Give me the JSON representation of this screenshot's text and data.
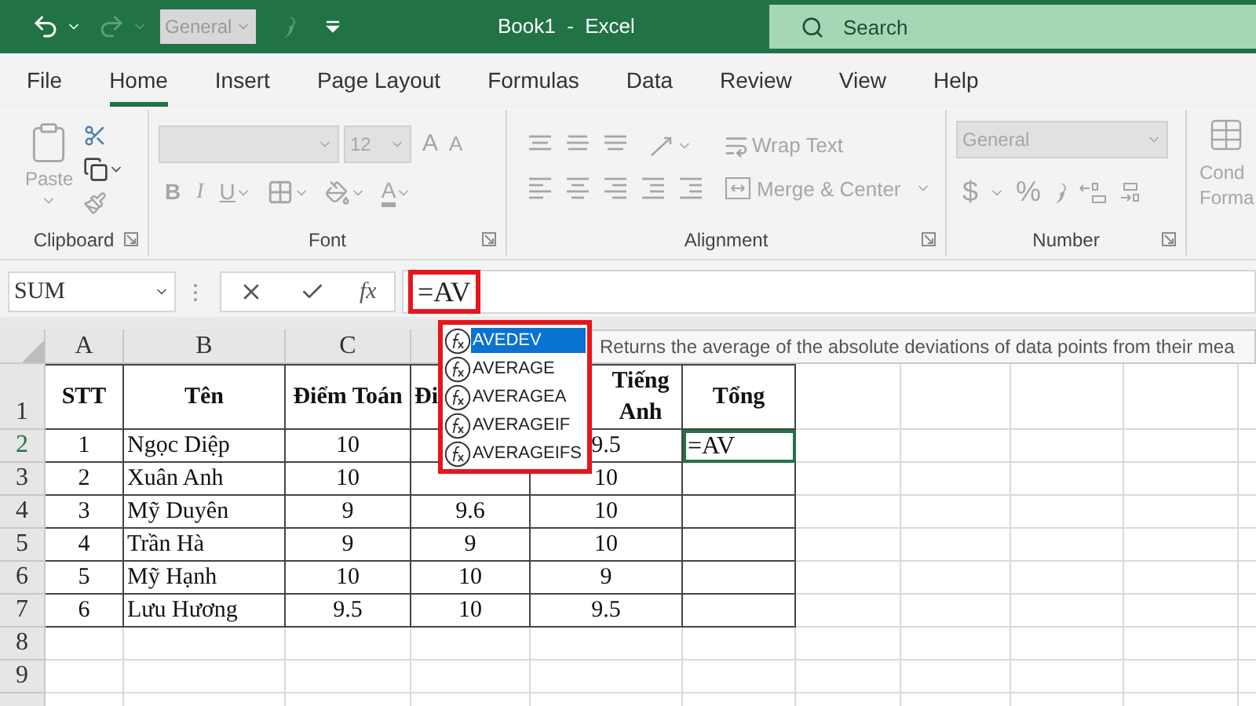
{
  "title_bar": {
    "number_format": "General",
    "title": "Book1  -  Excel",
    "search_placeholder": "Search"
  },
  "menu_tabs": [
    {
      "label": "File",
      "selected": false
    },
    {
      "label": "Home",
      "selected": true
    },
    {
      "label": "Insert",
      "selected": false
    },
    {
      "label": "Page Layout",
      "selected": false
    },
    {
      "label": "Formulas",
      "selected": false
    },
    {
      "label": "Data",
      "selected": false
    },
    {
      "label": "Review",
      "selected": false
    },
    {
      "label": "View",
      "selected": false
    },
    {
      "label": "Help",
      "selected": false
    }
  ],
  "ribbon": {
    "disabled": true,
    "paste": "Paste",
    "font_size": "12",
    "grow_font": "A",
    "shrink_font": "A",
    "bold": "B",
    "italic": "I",
    "underline": "U",
    "font_color": "A",
    "wrap_text": "Wrap Text",
    "merge_center": "Merge & Center",
    "number_format": "General",
    "currency": "$",
    "percent": "%",
    "conditional_formatting": [
      "Cond",
      "Forma"
    ],
    "groups": [
      {
        "label": "Clipboard"
      },
      {
        "label": "Font"
      },
      {
        "label": "Alignment"
      },
      {
        "label": "Number"
      }
    ]
  },
  "formula_bar": {
    "name_box": "SUM",
    "insert_function": "fx",
    "formula": "=AV",
    "highlighted": true
  },
  "sheet": {
    "columns": [
      {
        "label": "A"
      },
      {
        "label": "B"
      },
      {
        "label": "C"
      }
    ],
    "rows": [
      {
        "number": "1",
        "kind": "header",
        "selected": false,
        "cells": {
          "A": "STT",
          "B": "Tên",
          "C": "Điểm Toán",
          "D": "Đi",
          "E": "Tiếng Anh",
          "F": "Tổng"
        }
      },
      {
        "number": "2",
        "kind": "data",
        "selected": true,
        "cells": {
          "A": "1",
          "B": "Ngọc Diệp",
          "C": "10",
          "E": "9.5",
          "F": {
            "text": "=AV",
            "selected": true
          }
        }
      },
      {
        "number": "3",
        "kind": "data",
        "selected": false,
        "cells": {
          "A": "2",
          "B": "Xuân Anh",
          "C": "10",
          "E": "10"
        }
      },
      {
        "number": "4",
        "kind": "data",
        "selected": false,
        "cells": {
          "A": "3",
          "B": "Mỹ Duyên",
          "C": "9",
          "D": "9.6",
          "E": "10"
        }
      },
      {
        "number": "5",
        "kind": "data",
        "selected": false,
        "cells": {
          "A": "4",
          "B": "Trần Hà",
          "C": "9",
          "D": "9",
          "E": "10"
        }
      },
      {
        "number": "6",
        "kind": "data",
        "selected": false,
        "cells": {
          "A": "5",
          "B": "Mỹ Hạnh",
          "C": "10",
          "D": "10",
          "E": "9"
        }
      },
      {
        "number": "7",
        "kind": "data",
        "selected": false,
        "cells": {
          "A": "6",
          "B": "Lưu Hương",
          "C": "9.5",
          "D": "10",
          "E": "9.5"
        }
      },
      {
        "number": "8",
        "kind": "blank",
        "selected": false,
        "cells": {}
      },
      {
        "number": "9",
        "kind": "blank",
        "selected": false,
        "cells": {}
      }
    ]
  },
  "autocomplete": {
    "highlighted": true,
    "items": [
      {
        "label": "AVEDEV",
        "selected": true
      },
      {
        "label": "AVERAGE",
        "selected": false
      },
      {
        "label": "AVERAGEA",
        "selected": false
      },
      {
        "label": "AVERAGEIF",
        "selected": false
      },
      {
        "label": "AVERAGEIFS",
        "selected": false
      }
    ]
  },
  "tooltip": {
    "text": "Returns the average of the absolute deviations of data points from their mea"
  }
}
